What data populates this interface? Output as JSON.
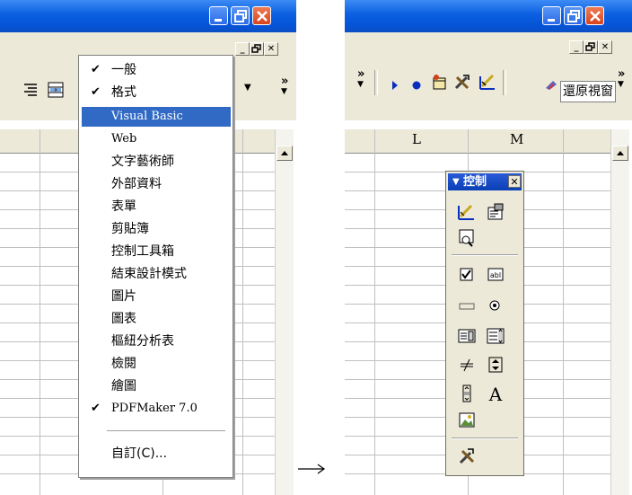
{
  "menu": {
    "items": [
      {
        "label": "一般",
        "checked": true
      },
      {
        "label": "格式",
        "checked": true
      },
      {
        "label": "Visual Basic",
        "checked": false,
        "selected": true
      },
      {
        "label": "Web",
        "checked": false
      },
      {
        "label": "文字藝術師",
        "checked": false
      },
      {
        "label": "外部資料",
        "checked": false
      },
      {
        "label": "表單",
        "checked": false
      },
      {
        "label": "剪貼簿",
        "checked": false
      },
      {
        "label": "控制工具箱",
        "checked": false
      },
      {
        "label": "結束設計模式",
        "checked": false
      },
      {
        "label": "圖片",
        "checked": false
      },
      {
        "label": "圖表",
        "checked": false
      },
      {
        "label": "樞紐分析表",
        "checked": false
      },
      {
        "label": "檢閱",
        "checked": false
      },
      {
        "label": "繪圖",
        "checked": false
      },
      {
        "label": "PDFMaker 7.0",
        "checked": true
      }
    ],
    "customize": "自訂(C)..."
  },
  "right": {
    "columns": [
      "L",
      "M"
    ],
    "restore_label": "還原視窗",
    "toolbox_title": "控制"
  },
  "colors": {
    "titlebar": "#0a5fe0",
    "menu_highlight": "#316ac5",
    "chrome": "#ece9d8"
  }
}
